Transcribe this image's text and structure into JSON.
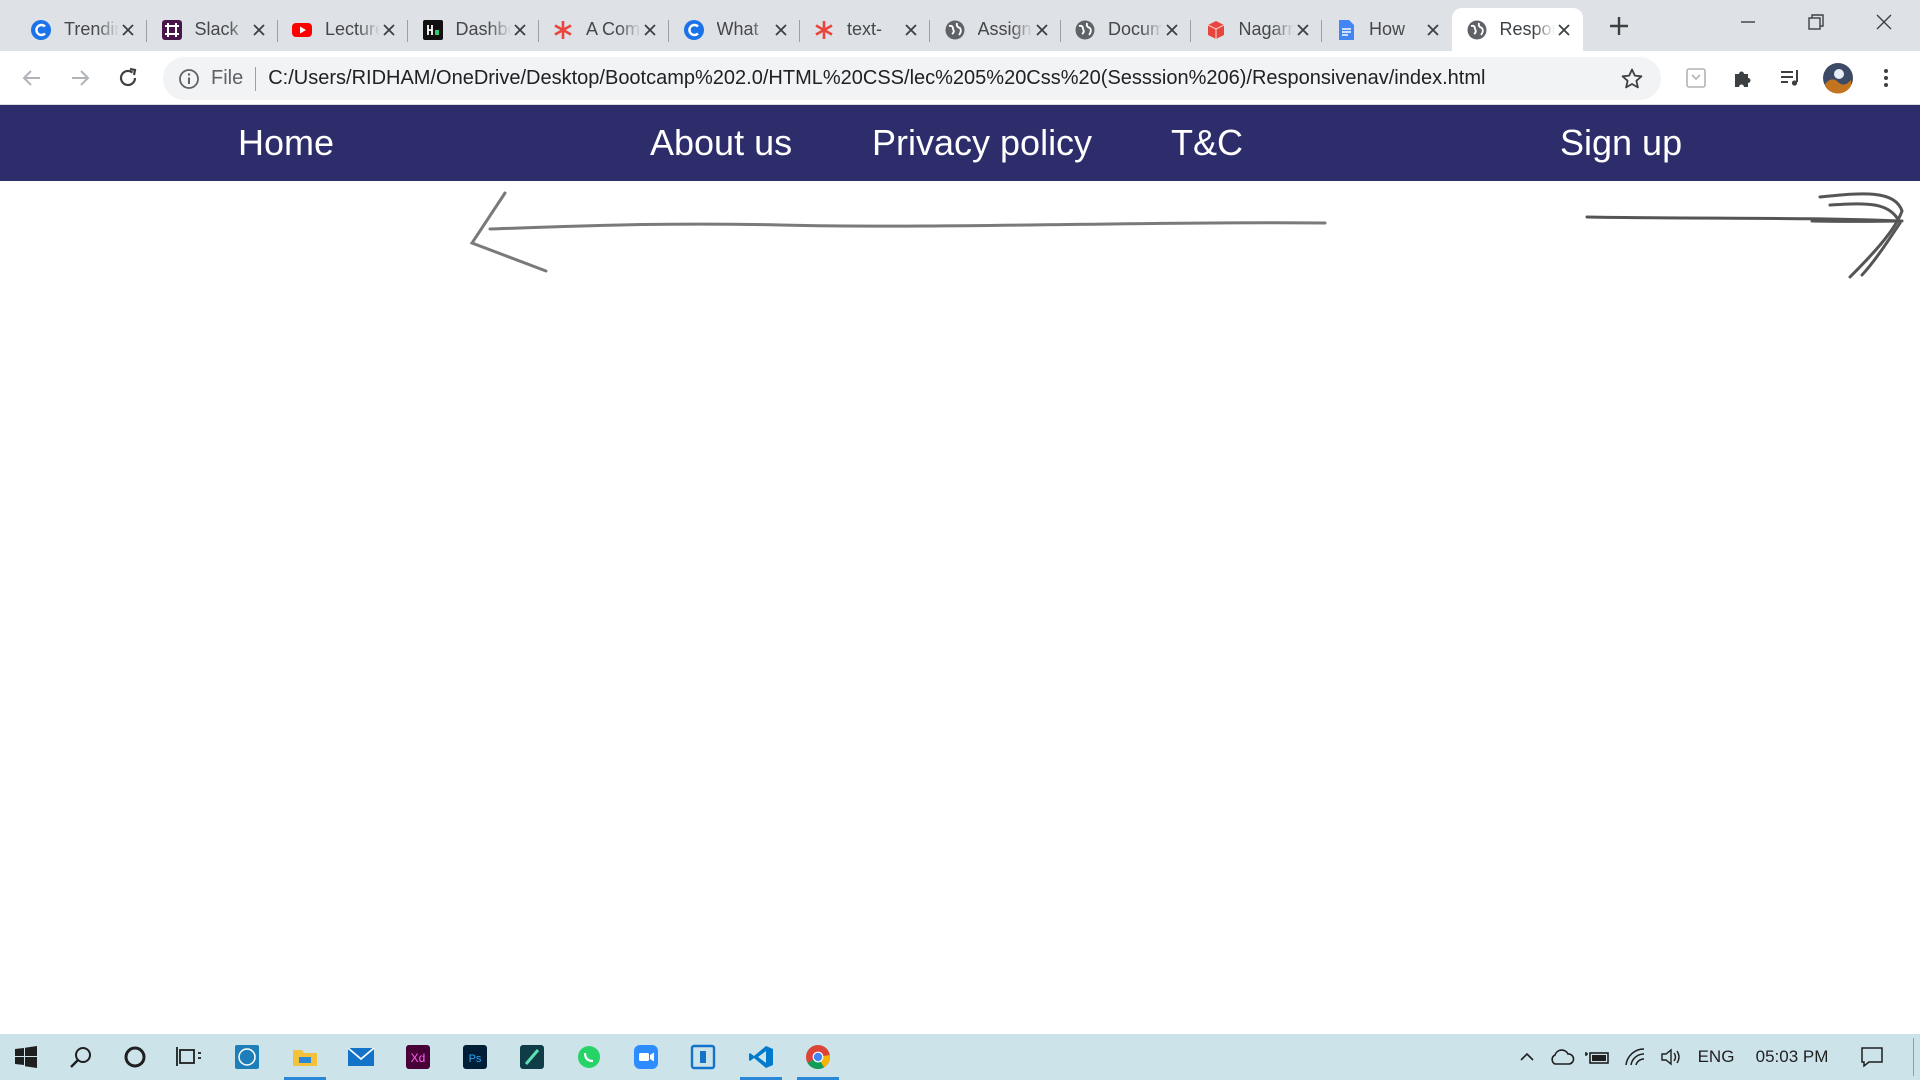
{
  "browser": {
    "tabs": [
      {
        "title": "Trending",
        "icon": "c-logo-icon",
        "color": "#1a73e8"
      },
      {
        "title": "Slack",
        "icon": "slack-icon",
        "color": "#4a154b"
      },
      {
        "title": "Lecture",
        "icon": "youtube-icon",
        "color": "#ff0000"
      },
      {
        "title": "Dashboard",
        "icon": "dashboard-icon",
        "color": "#111111"
      },
      {
        "title": "A Complete",
        "icon": "asterisk-icon",
        "color": "#e8453c"
      },
      {
        "title": "What",
        "icon": "c-logo-icon",
        "color": "#1a73e8"
      },
      {
        "title": "text-",
        "icon": "asterisk-icon",
        "color": "#e8453c"
      },
      {
        "title": "Assignment",
        "icon": "globe-icon",
        "color": "#5f6368"
      },
      {
        "title": "Document",
        "icon": "globe-icon",
        "color": "#5f6368"
      },
      {
        "title": "Nagarro",
        "icon": "box-icon",
        "color": "#e8453c"
      },
      {
        "title": "How",
        "icon": "docs-icon",
        "color": "#4285f4"
      },
      {
        "title": "Responsive",
        "icon": "globe-icon",
        "color": "#5f6368",
        "active": true
      }
    ],
    "address": {
      "scheme": "File",
      "url": "C:/Users/RIDHAM/OneDrive/Desktop/Bootcamp%202.0/HTML%20CSS/lec%205%20Css%20(Sesssion%206)/Responsivenav/index.html"
    }
  },
  "page": {
    "nav": {
      "home": "Home",
      "about": "About us",
      "privacy": "Privacy policy",
      "tnc": "T&C",
      "signup": "Sign up"
    },
    "colors": {
      "navbar_bg": "#2e2d6b",
      "nav_text": "#ffffff"
    }
  },
  "taskbar": {
    "language": "ENG",
    "time": "05:03 PM"
  }
}
